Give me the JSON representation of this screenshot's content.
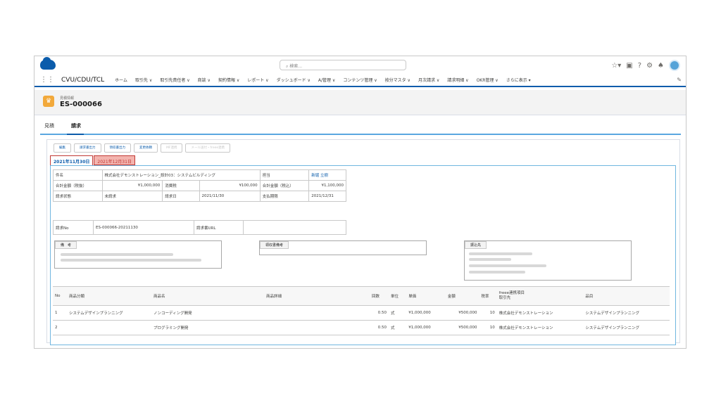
{
  "search": {
    "placeholder": "検索..."
  },
  "app": {
    "name": "CVU/CDU/TCL"
  },
  "nav": [
    "ホーム",
    "取引先 ∨",
    "取引先責任者 ∨",
    "商談 ∨",
    "契約情報 ∨",
    "レポート ∨",
    "ダッシュボード ∨",
    "A/管理 ∨",
    "コンテンツ管理 ∨",
    "按分マスタ ∨",
    "月次請求 ∨",
    "請求明細 ∨",
    "OKR管理 ∨",
    "さらに表示 ▾"
  ],
  "record": {
    "object_label": "見積情報",
    "name": "ES-000066"
  },
  "tabs": [
    "見積",
    "請求"
  ],
  "actions": [
    "編集",
    "請求書出力",
    "領収書出力",
    "変更依頼",
    "MF連携",
    "メール送付・freee連携"
  ],
  "date_tabs": [
    "2021年11月30日",
    "2021年12月31日"
  ],
  "info": {
    "subject_label": "件名",
    "subject": "株式会社デモンストレーション_設計03：システムビルディング",
    "owner_label": "担当",
    "owner": "新堀 立樹",
    "total_ex_label": "合計金額（税抜）",
    "total_ex": "¥1,000,000",
    "tax_label": "消費税",
    "tax": "¥100,000",
    "total_in_label": "合計金額（税込）",
    "total_in": "¥1,100,000",
    "status_label": "請求状態",
    "status": "未請求",
    "invoice_date_label": "請求日",
    "invoice_date": "2021/11/30",
    "due_label": "支払期限",
    "due": "2021/12/31",
    "no_label": "請求No",
    "no": "ES-000066-20211130",
    "url_label": "請求書URL",
    "url": ""
  },
  "remarks": {
    "note_label": "備　考",
    "receipt_label": "領収書備考",
    "bank_label": "振込先"
  },
  "items": {
    "headers": {
      "no": "No",
      "category": "商品分類",
      "product": "商品名",
      "detail": "商品詳細",
      "count": "回数",
      "unit": "単位",
      "price": "単価",
      "amount": "金額",
      "taxrate": "税率",
      "freee": "freee連携項目",
      "client": "取引先",
      "item": "品目"
    },
    "rows": [
      {
        "no": "1",
        "category": "システムデザインプランニング",
        "product": "ノンコーディング開発",
        "detail": "",
        "count": "0.50",
        "unit": "式",
        "price": "¥1,000,000",
        "amount": "¥500,000",
        "taxrate": "10",
        "client": "株式会社デモンストレーション",
        "item": "システムデザインプランニング"
      },
      {
        "no": "2",
        "category": "",
        "product": "プログラミング開発",
        "detail": "",
        "count": "0.50",
        "unit": "式",
        "price": "¥1,000,000",
        "amount": "¥500,000",
        "taxrate": "10",
        "client": "株式会社デモンストレーション",
        "item": "システムデザインプランニング"
      }
    ]
  }
}
